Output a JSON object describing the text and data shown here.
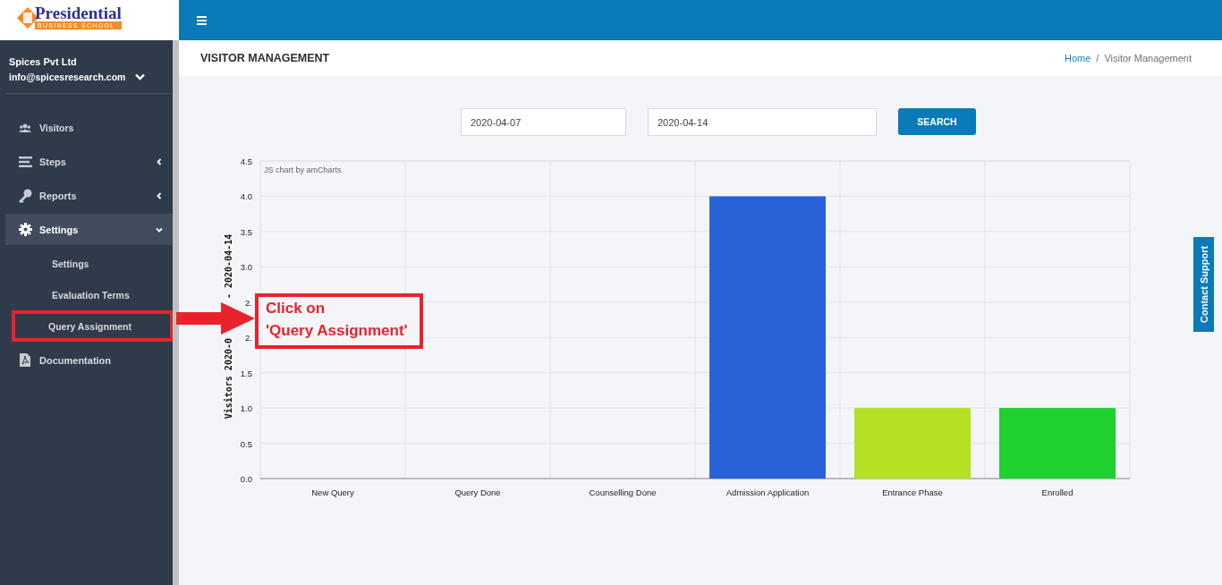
{
  "logo": {
    "name": "Presidential",
    "subtitle": "BUSINESS SCHOOL"
  },
  "account": {
    "company": "Spices Pvt Ltd",
    "email": "info@spicesresearch.com"
  },
  "sidebar": {
    "items": [
      {
        "label": "Visitors",
        "expandable": false,
        "expanded": false
      },
      {
        "label": "Steps",
        "expandable": true,
        "expanded": false
      },
      {
        "label": "Reports",
        "expandable": true,
        "expanded": false
      },
      {
        "label": "Settings",
        "expandable": true,
        "expanded": true,
        "children": [
          {
            "label": "Settings"
          },
          {
            "label": "Evaluation Terms"
          },
          {
            "label": "Query Assignment",
            "highlighted": true
          }
        ]
      },
      {
        "label": "Documentation",
        "expandable": false,
        "expanded": false
      }
    ]
  },
  "header": {
    "title": "VISITOR MANAGEMENT",
    "breadcrumb": [
      "Home",
      "Visitor Management"
    ],
    "separator": "/"
  },
  "filters": {
    "from": "2020-04-07",
    "to": "2020-04-14",
    "button": "SEARCH"
  },
  "chart": {
    "credit": "JS chart by amCharts",
    "ylabel_tail": "- 2020-04-14",
    "chart_data": {
      "type": "bar",
      "grid": true,
      "ylabel": "Visitors 2020-0",
      "categories": [
        "New Query",
        "Query Done",
        "Counselling Done",
        "Admission Application",
        "Entrance Phase",
        "Enrolled"
      ],
      "series": [
        {
          "colors": [
            null,
            null,
            null,
            "#2962d9",
            "#b6e024",
            "#1fd12f"
          ],
          "values": [
            0,
            0,
            0,
            4,
            1,
            1
          ]
        }
      ],
      "ylim": [
        0,
        4.5
      ],
      "yticks": [
        {
          "value": 0,
          "label": "0.0"
        },
        {
          "value": 0.5,
          "label": "0.5"
        },
        {
          "value": 1,
          "label": "1.0"
        },
        {
          "value": 1.5,
          "label": "1.5"
        },
        {
          "value": 2,
          "label": "2."
        },
        {
          "value": 2.5,
          "label": "2."
        },
        {
          "value": 3,
          "label": "3.0"
        },
        {
          "value": 3.5,
          "label": "3.5"
        },
        {
          "value": 4,
          "label": "4.0"
        },
        {
          "value": 4.5,
          "label": "4.5"
        }
      ]
    }
  },
  "annotation": {
    "lines": [
      "Click on",
      "'Query Assignment'"
    ]
  },
  "contact_tab": {
    "label": "Contact Support"
  }
}
